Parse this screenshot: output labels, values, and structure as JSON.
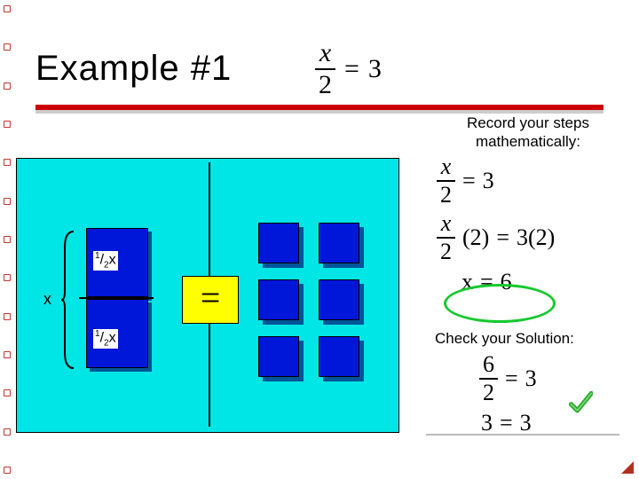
{
  "title": "Example #1",
  "equation": {
    "numerator": "x",
    "denominator": "2",
    "equals": "=",
    "rhs": "3"
  },
  "record_label": "Record your steps mathematically:",
  "steps": {
    "line1": {
      "num": "x",
      "den": "2",
      "eq": "=",
      "rhs": "3"
    },
    "line2": {
      "num": "x",
      "den": "2",
      "mult": "(2)",
      "eq": "=",
      "rhs": "3(2)"
    },
    "line3": {
      "lhs": "x",
      "eq": "=",
      "rhs": "6"
    }
  },
  "check_label": "Check your Solution:",
  "verify": {
    "line1": {
      "num": "6",
      "den": "2",
      "eq": "=",
      "rhs": "3"
    },
    "line2": {
      "lhs": "3",
      "eq": "=",
      "rhs": "3"
    }
  },
  "mat": {
    "x_label": "x",
    "half_top": "1/2x",
    "half_bot": "1/2x",
    "equals": "="
  },
  "images": {
    "checkmark": "check-icon"
  }
}
